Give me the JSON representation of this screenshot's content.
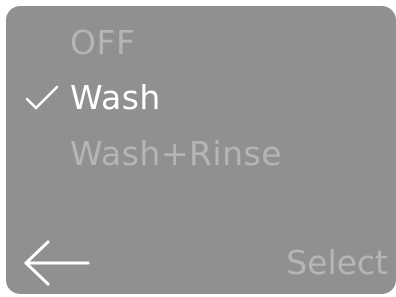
{
  "menu": {
    "items": [
      {
        "label": "OFF",
        "selected": false
      },
      {
        "label": "Wash",
        "selected": true
      },
      {
        "label": "Wash+Rinse",
        "selected": false
      }
    ]
  },
  "footer": {
    "back_icon": "arrow-left-icon",
    "select_label": "Select"
  },
  "colors": {
    "background": "#909092",
    "active_text": "#ffffff",
    "inactive_text": "#b5b5b7"
  }
}
